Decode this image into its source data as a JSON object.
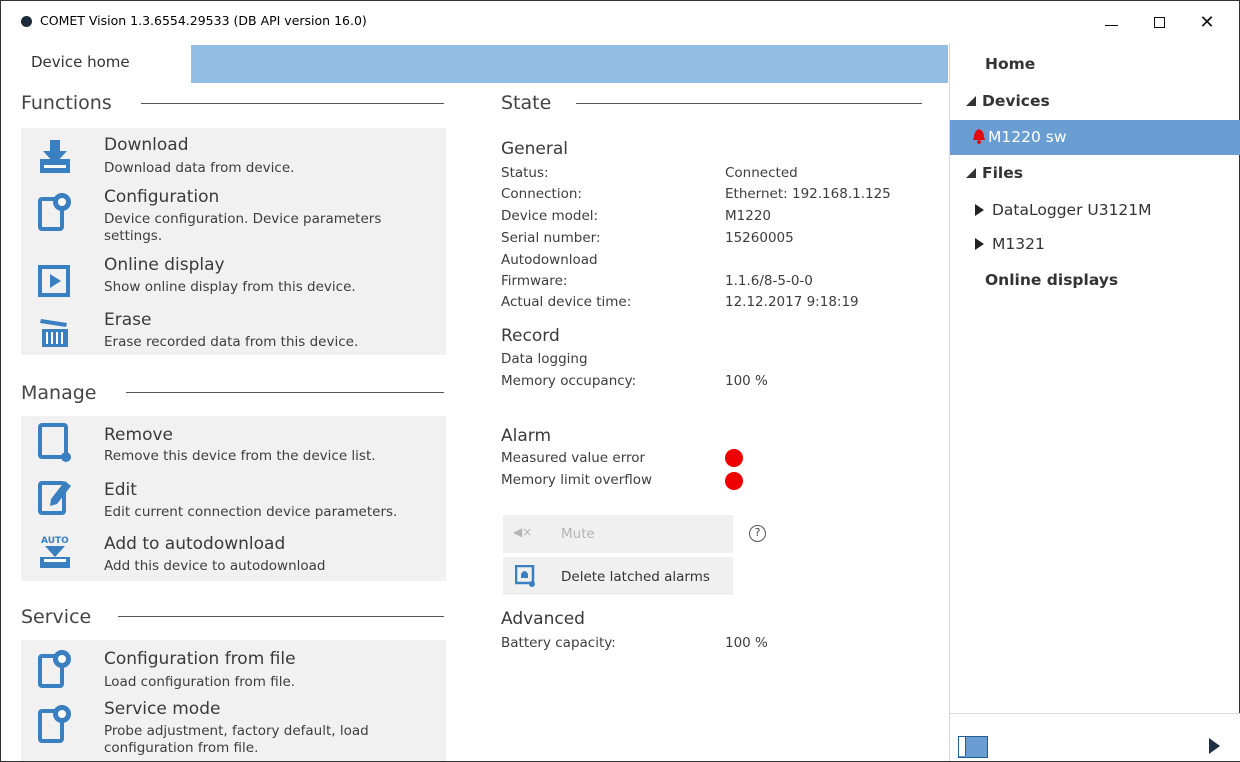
{
  "window": {
    "title": "COMET Vision 1.3.6554.29533 (DB API version 16.0)",
    "minimize_icon": "minimize-icon",
    "maximize_icon": "maximize-icon",
    "close_glyph": "✕"
  },
  "tab": {
    "label": "Device home"
  },
  "functions": {
    "heading": "Functions",
    "items": [
      {
        "title": "Download",
        "desc": "Download data from device.",
        "icon": "download-icon"
      },
      {
        "title": "Configuration",
        "desc": "Device configuration. Device parameters settings.",
        "icon": "configuration-icon"
      },
      {
        "title": "Online display",
        "desc": "Show online display from this device.",
        "icon": "online-display-icon"
      },
      {
        "title": "Erase",
        "desc": "Erase recorded data from this device.",
        "icon": "erase-icon"
      }
    ]
  },
  "manage": {
    "heading": "Manage",
    "items": [
      {
        "title": "Remove",
        "desc": "Remove this device from the device list.",
        "icon": "remove-device-icon"
      },
      {
        "title": "Edit",
        "desc": "Edit current connection device parameters.",
        "icon": "edit-icon"
      },
      {
        "title": "Add to autodownload",
        "desc": "Add this device to autodownload",
        "icon": "autodownload-icon",
        "icon_text": "AUTO"
      }
    ]
  },
  "service": {
    "heading": "Service",
    "items": [
      {
        "title": "Configuration from file",
        "desc": "Load configuration from file.",
        "icon": "configuration-file-icon"
      },
      {
        "title": "Service mode",
        "desc": "Probe adjustment, factory default, load configuration from file.",
        "icon": "service-mode-icon"
      }
    ]
  },
  "state": {
    "heading": "State",
    "general": {
      "title": "General",
      "rows": [
        {
          "label": "Status:",
          "value": "Connected"
        },
        {
          "label": "Connection:",
          "value": "Ethernet: 192.168.1.125"
        },
        {
          "label": "Device model:",
          "value": "M1220"
        },
        {
          "label": "Serial number:",
          "value": "15260005"
        },
        {
          "label": "Autodownload",
          "value": ""
        },
        {
          "label": "Firmware:",
          "value": "1.1.6/8-5-0-0"
        },
        {
          "label": "Actual device time:",
          "value": "12.12.2017 9:18:19"
        }
      ]
    },
    "record": {
      "title": "Record",
      "rows": [
        {
          "label": "Data logging",
          "value": ""
        },
        {
          "label": "Memory occupancy:",
          "value": "100 %"
        }
      ]
    },
    "alarm": {
      "title": "Alarm",
      "rows": [
        {
          "label": "Measured value error",
          "status_color": "#ee0000"
        },
        {
          "label": "Memory limit overflow",
          "status_color": "#ee0000"
        }
      ],
      "mute_label": "Mute",
      "mute_icon": "speaker-muted-icon",
      "mute_glyph": "◀×",
      "help_glyph": "?",
      "delete_label": "Delete latched alarms",
      "delete_icon": "latched-alarm-icon"
    },
    "advanced": {
      "title": "Advanced",
      "rows": [
        {
          "label": "Battery capacity:",
          "value": "100 %"
        }
      ]
    }
  },
  "sidebar": {
    "home": "Home",
    "devices": "Devices",
    "device_selected": "M1220 sw",
    "files": "Files",
    "file_items": [
      "DataLogger U3121M",
      "M1321"
    ],
    "online_displays": "Online displays",
    "accent_color": "#6a9ed3"
  }
}
